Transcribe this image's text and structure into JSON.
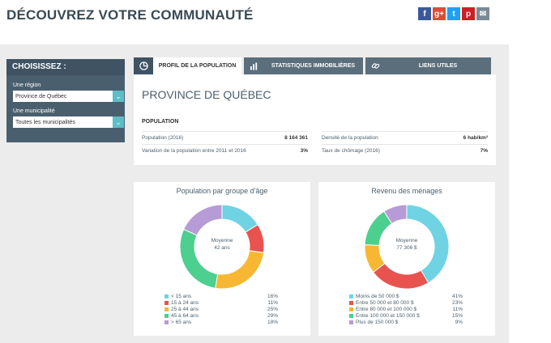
{
  "header": {
    "title": "DÉCOUVREZ VOTRE COMMUNAUTÉ"
  },
  "social": [
    {
      "name": "facebook-icon",
      "glyph": "f",
      "color": "#3b5998"
    },
    {
      "name": "googleplus-icon",
      "glyph": "g+",
      "color": "#dd4b39"
    },
    {
      "name": "twitter-icon",
      "glyph": "t",
      "color": "#1da1f2"
    },
    {
      "name": "pinterest-icon",
      "glyph": "p",
      "color": "#cb2027"
    },
    {
      "name": "email-icon",
      "glyph": "✉",
      "color": "#7a8a94"
    }
  ],
  "sidebar": {
    "title": "CHOISISSEZ :",
    "region_label": "Une région",
    "region_value": "Province de Québec",
    "municipality_label": "Une municipalité",
    "municipality_value": "Toutes les municipalités"
  },
  "tabs": {
    "profile": "PROFIL DE LA POPULATION",
    "stats": "STATISTIQUES IMMOBILIÈRES",
    "links": "LIENS UTILES"
  },
  "profile": {
    "title": "PROVINCE DE QUÉBEC",
    "section": "POPULATION",
    "pop_label": "Population (2016)",
    "pop_value": "8 164 361",
    "var_label": "Variation de la population entre 2011 et 2016",
    "var_value": "3%",
    "density_label": "Densité de la population",
    "density_value": "6 hab/km²",
    "unemp_label": "Taux de chômage (2016)",
    "unemp_value": "7%"
  },
  "chart_data": [
    {
      "type": "pie",
      "title": "Population par groupe d'âge",
      "center_label": "Moyenne",
      "center_value": "42 ans",
      "slices": [
        {
          "label": "< 15 ans",
          "value": 16,
          "display": "16%",
          "color": "#6fd3e3"
        },
        {
          "label": "15 à 24 ans",
          "value": 11,
          "display": "11%",
          "color": "#e8534f"
        },
        {
          "label": "25 à 44 ans",
          "value": 25,
          "display": "25%",
          "color": "#f7b733"
        },
        {
          "label": "45 à 64 ans",
          "value": 29,
          "display": "29%",
          "color": "#4ccf8f"
        },
        {
          "label": "> 65 ans",
          "value": 18,
          "display": "18%",
          "color": "#b79bd6"
        }
      ]
    },
    {
      "type": "pie",
      "title": "Revenu des ménages",
      "center_label": "Moyenne",
      "center_value": "77 306 $",
      "slices": [
        {
          "label": "Moins de 50 000 $",
          "value": 41,
          "display": "41%",
          "color": "#6fd3e3"
        },
        {
          "label": "Entre 50 000 et 80 000 $",
          "value": 23,
          "display": "23%",
          "color": "#e8534f"
        },
        {
          "label": "Entre 80 000 et 100 000 $",
          "value": 11,
          "display": "11%",
          "color": "#f7b733"
        },
        {
          "label": "Entre 100 000 et 150 000 $",
          "value": 15,
          "display": "15%",
          "color": "#4ccf8f"
        },
        {
          "label": "Plus de 150 000 $",
          "value": 9,
          "display": "9%",
          "color": "#b79bd6"
        }
      ]
    }
  ]
}
